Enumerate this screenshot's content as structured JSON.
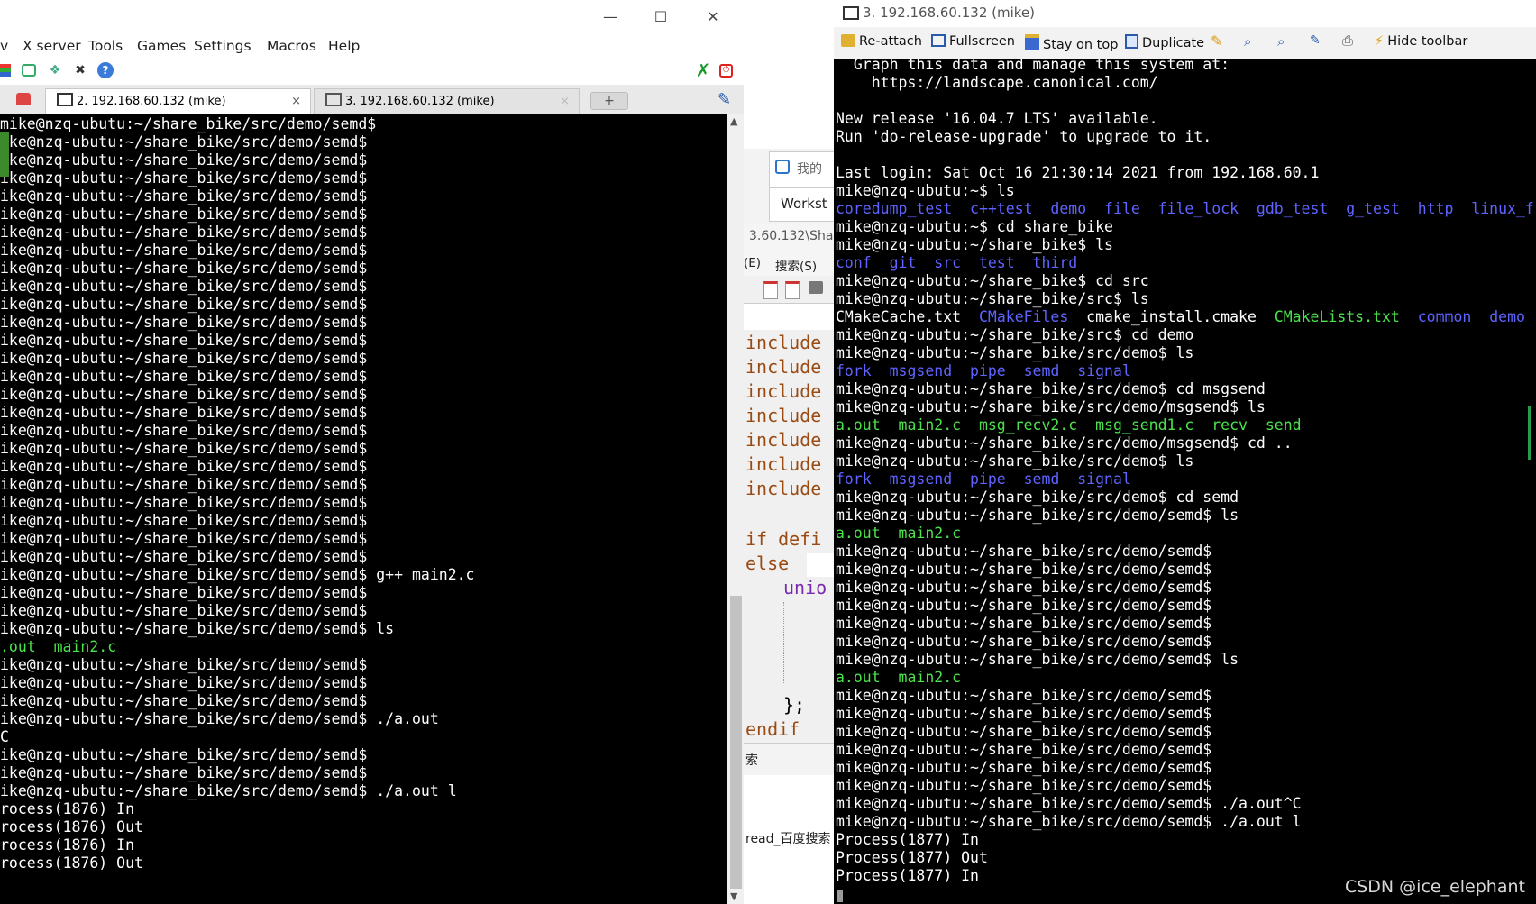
{
  "left_window": {
    "menu": [
      "X server",
      "Tools",
      "Games",
      "Settings",
      "Macros",
      "Help"
    ],
    "menu_cut": "v",
    "tabs": [
      {
        "label": "2. 192.168.60.132 (mike)",
        "close": "×"
      },
      {
        "label": "3. 192.168.60.132 (mike)",
        "close": "×"
      }
    ],
    "lines": [
      {
        "t": "mike@nzq-ubutu:~/share_bike/src/demo/semd$",
        "c": ""
      },
      {
        "t": "ike@nzq-ubutu:~/share_bike/src/demo/semd$",
        "c": ""
      },
      {
        "t": "ike@nzq-ubutu:~/share_bike/src/demo/semd$",
        "c": ""
      },
      {
        "t": "ike@nzq-ubutu:~/share_bike/src/demo/semd$",
        "c": ""
      },
      {
        "t": "ike@nzq-ubutu:~/share_bike/src/demo/semd$",
        "c": ""
      },
      {
        "t": "ike@nzq-ubutu:~/share_bike/src/demo/semd$",
        "c": ""
      },
      {
        "t": "ike@nzq-ubutu:~/share_bike/src/demo/semd$",
        "c": ""
      },
      {
        "t": "ike@nzq-ubutu:~/share_bike/src/demo/semd$",
        "c": ""
      },
      {
        "t": "ike@nzq-ubutu:~/share_bike/src/demo/semd$",
        "c": ""
      },
      {
        "t": "ike@nzq-ubutu:~/share_bike/src/demo/semd$",
        "c": ""
      },
      {
        "t": "ike@nzq-ubutu:~/share_bike/src/demo/semd$",
        "c": ""
      },
      {
        "t": "ike@nzq-ubutu:~/share_bike/src/demo/semd$",
        "c": ""
      },
      {
        "t": "ike@nzq-ubutu:~/share_bike/src/demo/semd$",
        "c": ""
      },
      {
        "t": "ike@nzq-ubutu:~/share_bike/src/demo/semd$",
        "c": ""
      },
      {
        "t": "ike@nzq-ubutu:~/share_bike/src/demo/semd$",
        "c": ""
      },
      {
        "t": "ike@nzq-ubutu:~/share_bike/src/demo/semd$",
        "c": ""
      },
      {
        "t": "ike@nzq-ubutu:~/share_bike/src/demo/semd$",
        "c": ""
      },
      {
        "t": "ike@nzq-ubutu:~/share_bike/src/demo/semd$",
        "c": ""
      },
      {
        "t": "ike@nzq-ubutu:~/share_bike/src/demo/semd$",
        "c": ""
      },
      {
        "t": "ike@nzq-ubutu:~/share_bike/src/demo/semd$",
        "c": ""
      },
      {
        "t": "ike@nzq-ubutu:~/share_bike/src/demo/semd$",
        "c": ""
      },
      {
        "t": "ike@nzq-ubutu:~/share_bike/src/demo/semd$",
        "c": ""
      },
      {
        "t": "ike@nzq-ubutu:~/share_bike/src/demo/semd$",
        "c": ""
      },
      {
        "t": "ike@nzq-ubutu:~/share_bike/src/demo/semd$",
        "c": ""
      },
      {
        "t": "ike@nzq-ubutu:~/share_bike/src/demo/semd$",
        "c": ""
      },
      {
        "t": "ike@nzq-ubutu:~/share_bike/src/demo/semd$ g++ main2.c",
        "c": ""
      },
      {
        "t": "ike@nzq-ubutu:~/share_bike/src/demo/semd$",
        "c": ""
      },
      {
        "t": "ike@nzq-ubutu:~/share_bike/src/demo/semd$",
        "c": ""
      },
      {
        "t": "ike@nzq-ubutu:~/share_bike/src/demo/semd$ ls",
        "c": ""
      },
      {
        "t": ".out  main2.c",
        "c": "green"
      },
      {
        "t": "ike@nzq-ubutu:~/share_bike/src/demo/semd$",
        "c": ""
      },
      {
        "t": "ike@nzq-ubutu:~/share_bike/src/demo/semd$",
        "c": ""
      },
      {
        "t": "ike@nzq-ubutu:~/share_bike/src/demo/semd$",
        "c": ""
      },
      {
        "t": "ike@nzq-ubutu:~/share_bike/src/demo/semd$ ./a.out",
        "c": ""
      },
      {
        "t": "C",
        "c": ""
      },
      {
        "t": "ike@nzq-ubutu:~/share_bike/src/demo/semd$",
        "c": ""
      },
      {
        "t": "ike@nzq-ubutu:~/share_bike/src/demo/semd$",
        "c": ""
      },
      {
        "t": "ike@nzq-ubutu:~/share_bike/src/demo/semd$ ./a.out l",
        "c": ""
      },
      {
        "t": "rocess(1876) In",
        "c": ""
      },
      {
        "t": "rocess(1876) Out",
        "c": ""
      },
      {
        "t": "rocess(1876) In",
        "c": ""
      },
      {
        "t": "rocess(1876) Out",
        "c": ""
      }
    ]
  },
  "middle_window": {
    "tab_text": "我的",
    "tab2_text": "Workst",
    "path_text": "3.60.132\\Shar",
    "menu_e": "(E)",
    "menu_search": "搜索(S)",
    "code_lines": [
      "include",
      "include",
      "include",
      "include",
      "include",
      "include",
      "include"
    ],
    "code_if": "if defi",
    "code_else": "else",
    "code_union": "unio",
    "code_brace": "};",
    "code_endif": "endif",
    "search_label": "索",
    "bottom_text": "read_百度搜索"
  },
  "right_window": {
    "title": "3. 192.168.60.132 (mike)",
    "toolbar": {
      "reattach": "Re-attach",
      "fullscreen": "Fullscreen",
      "stay_on_top": "Stay on top",
      "duplicate": "Duplicate",
      "hide_toolbar": "Hide toolbar"
    },
    "lines": [
      [
        {
          "t": "  Graph this data and manage this system at:",
          "c": ""
        }
      ],
      [
        {
          "t": "    https://landscape.canonical.com/",
          "c": ""
        }
      ],
      [
        {
          "t": "",
          "c": ""
        }
      ],
      [
        {
          "t": "New release '16.04.7 LTS' available.",
          "c": ""
        }
      ],
      [
        {
          "t": "Run 'do-release-upgrade' to upgrade to it.",
          "c": ""
        }
      ],
      [
        {
          "t": "",
          "c": ""
        }
      ],
      [
        {
          "t": "Last login: Sat Oct 16 21:30:14 2021 from 192.168.60.1",
          "c": ""
        }
      ],
      [
        {
          "t": "mike@nzq-ubutu:~$ ls",
          "c": ""
        }
      ],
      [
        {
          "t": "coredump_test  c++test  demo  file  file_lock  gdb_test  g_test  http  linux_f",
          "c": "blue"
        }
      ],
      [
        {
          "t": "mike@nzq-ubutu:~$ cd share_bike",
          "c": ""
        }
      ],
      [
        {
          "t": "mike@nzq-ubutu:~/share_bike$ ls",
          "c": ""
        }
      ],
      [
        {
          "t": "conf  git  src  test  third",
          "c": "blue"
        }
      ],
      [
        {
          "t": "mike@nzq-ubutu:~/share_bike$ cd src",
          "c": ""
        }
      ],
      [
        {
          "t": "mike@nzq-ubutu:~/share_bike/src$ ls",
          "c": ""
        }
      ],
      [
        {
          "t": "CMakeCache.txt  ",
          "c": ""
        },
        {
          "t": "CMakeFiles",
          "c": "blue"
        },
        {
          "t": "  cmake_install.cmake  ",
          "c": ""
        },
        {
          "t": "CMakeLists.txt",
          "c": "green"
        },
        {
          "t": "  ",
          "c": ""
        },
        {
          "t": "common  demo",
          "c": "blue"
        }
      ],
      [
        {
          "t": "mike@nzq-ubutu:~/share_bike/src$ cd demo",
          "c": ""
        }
      ],
      [
        {
          "t": "mike@nzq-ubutu:~/share_bike/src/demo$ ls",
          "c": ""
        }
      ],
      [
        {
          "t": "fork  msgsend  pipe  semd  signal",
          "c": "blue"
        }
      ],
      [
        {
          "t": "mike@nzq-ubutu:~/share_bike/src/demo$ cd msgsend",
          "c": ""
        }
      ],
      [
        {
          "t": "mike@nzq-ubutu:~/share_bike/src/demo/msgsend$ ls",
          "c": ""
        }
      ],
      [
        {
          "t": "a.out  main2.c  msg_recv2.c  msg_send1.c  recv  send",
          "c": "green"
        }
      ],
      [
        {
          "t": "mike@nzq-ubutu:~/share_bike/src/demo/msgsend$ cd ..",
          "c": ""
        }
      ],
      [
        {
          "t": "mike@nzq-ubutu:~/share_bike/src/demo$ ls",
          "c": ""
        }
      ],
      [
        {
          "t": "fork  msgsend  pipe  semd  signal",
          "c": "blue"
        }
      ],
      [
        {
          "t": "mike@nzq-ubutu:~/share_bike/src/demo$ cd semd",
          "c": ""
        }
      ],
      [
        {
          "t": "mike@nzq-ubutu:~/share_bike/src/demo/semd$ ls",
          "c": ""
        }
      ],
      [
        {
          "t": "a.out  main2.c",
          "c": "green"
        }
      ],
      [
        {
          "t": "mike@nzq-ubutu:~/share_bike/src/demo/semd$",
          "c": ""
        }
      ],
      [
        {
          "t": "mike@nzq-ubutu:~/share_bike/src/demo/semd$",
          "c": ""
        }
      ],
      [
        {
          "t": "mike@nzq-ubutu:~/share_bike/src/demo/semd$",
          "c": ""
        }
      ],
      [
        {
          "t": "mike@nzq-ubutu:~/share_bike/src/demo/semd$",
          "c": ""
        }
      ],
      [
        {
          "t": "mike@nzq-ubutu:~/share_bike/src/demo/semd$",
          "c": ""
        }
      ],
      [
        {
          "t": "mike@nzq-ubutu:~/share_bike/src/demo/semd$",
          "c": ""
        }
      ],
      [
        {
          "t": "mike@nzq-ubutu:~/share_bike/src/demo/semd$ ls",
          "c": ""
        }
      ],
      [
        {
          "t": "a.out  main2.c",
          "c": "green"
        }
      ],
      [
        {
          "t": "mike@nzq-ubutu:~/share_bike/src/demo/semd$",
          "c": ""
        }
      ],
      [
        {
          "t": "mike@nzq-ubutu:~/share_bike/src/demo/semd$",
          "c": ""
        }
      ],
      [
        {
          "t": "mike@nzq-ubutu:~/share_bike/src/demo/semd$",
          "c": ""
        }
      ],
      [
        {
          "t": "mike@nzq-ubutu:~/share_bike/src/demo/semd$",
          "c": ""
        }
      ],
      [
        {
          "t": "mike@nzq-ubutu:~/share_bike/src/demo/semd$",
          "c": ""
        }
      ],
      [
        {
          "t": "mike@nzq-ubutu:~/share_bike/src/demo/semd$",
          "c": ""
        }
      ],
      [
        {
          "t": "mike@nzq-ubutu:~/share_bike/src/demo/semd$ ./a.out^C",
          "c": ""
        }
      ],
      [
        {
          "t": "mike@nzq-ubutu:~/share_bike/src/demo/semd$ ./a.out l",
          "c": ""
        }
      ],
      [
        {
          "t": "Process(1877) In",
          "c": ""
        }
      ],
      [
        {
          "t": "Process(1877) Out",
          "c": ""
        }
      ],
      [
        {
          "t": "Process(1877) In",
          "c": ""
        }
      ]
    ]
  },
  "watermark": "CSDN @ice_elephant",
  "colors": {
    "terminal_bg": "#000000",
    "terminal_fg": "#ffffff",
    "ls_dir_blue": "#5f63ff",
    "ls_exec_green": "#4ce24c"
  }
}
